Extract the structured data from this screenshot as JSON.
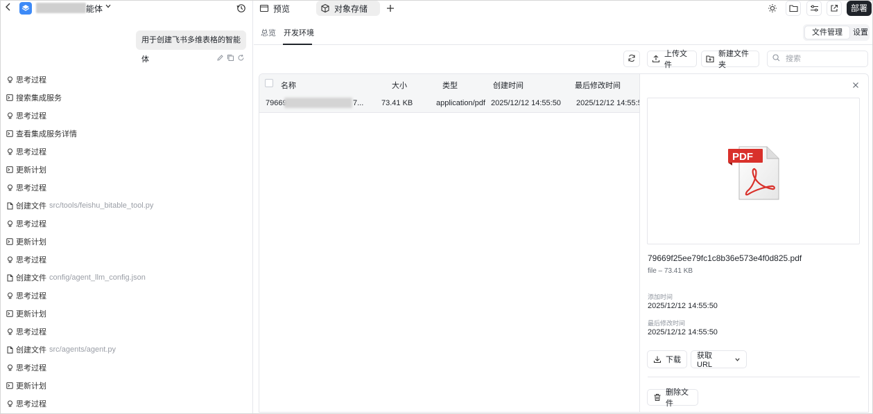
{
  "left": {
    "app_name_suffix": "能体",
    "user_message": "用于创建飞书多维表格的智能体",
    "steps": [
      {
        "type": "think",
        "label": "思考过程",
        "path": ""
      },
      {
        "type": "tool",
        "label": "搜索集成服务",
        "path": ""
      },
      {
        "type": "think",
        "label": "思考过程",
        "path": ""
      },
      {
        "type": "tool",
        "label": "查看集成服务详情",
        "path": ""
      },
      {
        "type": "think",
        "label": "思考过程",
        "path": ""
      },
      {
        "type": "tool",
        "label": "更新计划",
        "path": ""
      },
      {
        "type": "think",
        "label": "思考过程",
        "path": ""
      },
      {
        "type": "file",
        "label": "创建文件",
        "path": "src/tools/feishu_bitable_tool.py"
      },
      {
        "type": "think",
        "label": "思考过程",
        "path": ""
      },
      {
        "type": "tool",
        "label": "更新计划",
        "path": ""
      },
      {
        "type": "think",
        "label": "思考过程",
        "path": ""
      },
      {
        "type": "file",
        "label": "创建文件",
        "path": "config/agent_llm_config.json"
      },
      {
        "type": "think",
        "label": "思考过程",
        "path": ""
      },
      {
        "type": "tool",
        "label": "更新计划",
        "path": ""
      },
      {
        "type": "think",
        "label": "思考过程",
        "path": ""
      },
      {
        "type": "file",
        "label": "创建文件",
        "path": "src/agents/agent.py"
      },
      {
        "type": "think",
        "label": "思考过程",
        "path": ""
      },
      {
        "type": "tool",
        "label": "更新计划",
        "path": ""
      },
      {
        "type": "think",
        "label": "思考过程",
        "path": ""
      }
    ]
  },
  "top": {
    "tab_preview": "预览",
    "tab_storage": "对象存储",
    "deploy_label": "部署"
  },
  "subtabs": {
    "overview": "总览",
    "dev_env": "开发环境",
    "file_manage": "文件管理",
    "settings": "设置"
  },
  "toolbar": {
    "upload_label": "上传文件",
    "new_folder_label": "新建文件夹",
    "search_placeholder": "搜索"
  },
  "table": {
    "headers": {
      "name": "名称",
      "size": "大小",
      "type": "类型",
      "created": "创建时间",
      "modified": "最后修改时间"
    },
    "rows": [
      {
        "name_prefix": "79669",
        "name_suffix": "7...",
        "size": "73.41 KB",
        "type": "application/pdf",
        "created": "2025/12/12 14:55:50",
        "modified": "2025/12/12 14:55:5"
      }
    ]
  },
  "detail": {
    "file_name": "79669f25ee79fc1c8b36e573e4f0d825.pdf",
    "file_meta": "file – 73.41 KB",
    "added_label": "添加时间",
    "added_value": "2025/12/12 14:55:50",
    "modified_label": "最后修改时间",
    "modified_value": "2025/12/12 14:55:50",
    "download_label": "下载",
    "get_url_label": "获取 URL",
    "delete_label": "删除文件"
  },
  "colors": {
    "accent_dark": "#1f2329",
    "pdf_red": "#d9312b",
    "app_logo": "#3d8af7"
  }
}
